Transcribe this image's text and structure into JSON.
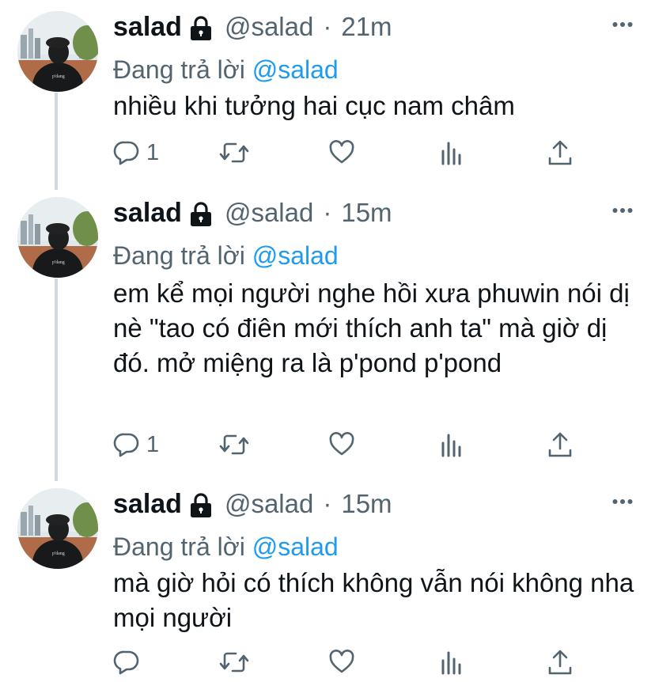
{
  "tweets": [
    {
      "name": "salad",
      "handle": "@salad",
      "dot": "·",
      "time": "21m",
      "reply_prefix": "Đang trả lời",
      "reply_mention": "@salad",
      "text": "nhiều khi tưởng hai cục nam châm",
      "reply_count": "1"
    },
    {
      "name": "salad",
      "handle": "@salad",
      "dot": "·",
      "time": "15m",
      "reply_prefix": "Đang trả lời",
      "reply_mention": "@salad",
      "text": "em kể mọi người nghe hồi xưa phuwin nói dị nè \"tao có điên mới thích anh ta\" mà giờ dị đó. mở miệng ra là p'pond p'pond",
      "reply_count": "1"
    },
    {
      "name": "salad",
      "handle": "@salad",
      "dot": "·",
      "time": "15m",
      "reply_prefix": "Đang trả lời",
      "reply_mention": "@salad",
      "text": "mà giờ hỏi có thích không vẫn nói không nha mọi người",
      "reply_count": ""
    }
  ],
  "icons": {
    "reply": "reply-icon",
    "retweet": "retweet-icon",
    "like": "like-icon",
    "analytics": "analytics-icon",
    "share": "share-icon",
    "more": "more-icon",
    "lock": "lock-icon"
  },
  "colors": {
    "text": "#0f1419",
    "secondary": "#536471",
    "mention": "#1d9bf0",
    "thread_line": "#cfd9de"
  }
}
